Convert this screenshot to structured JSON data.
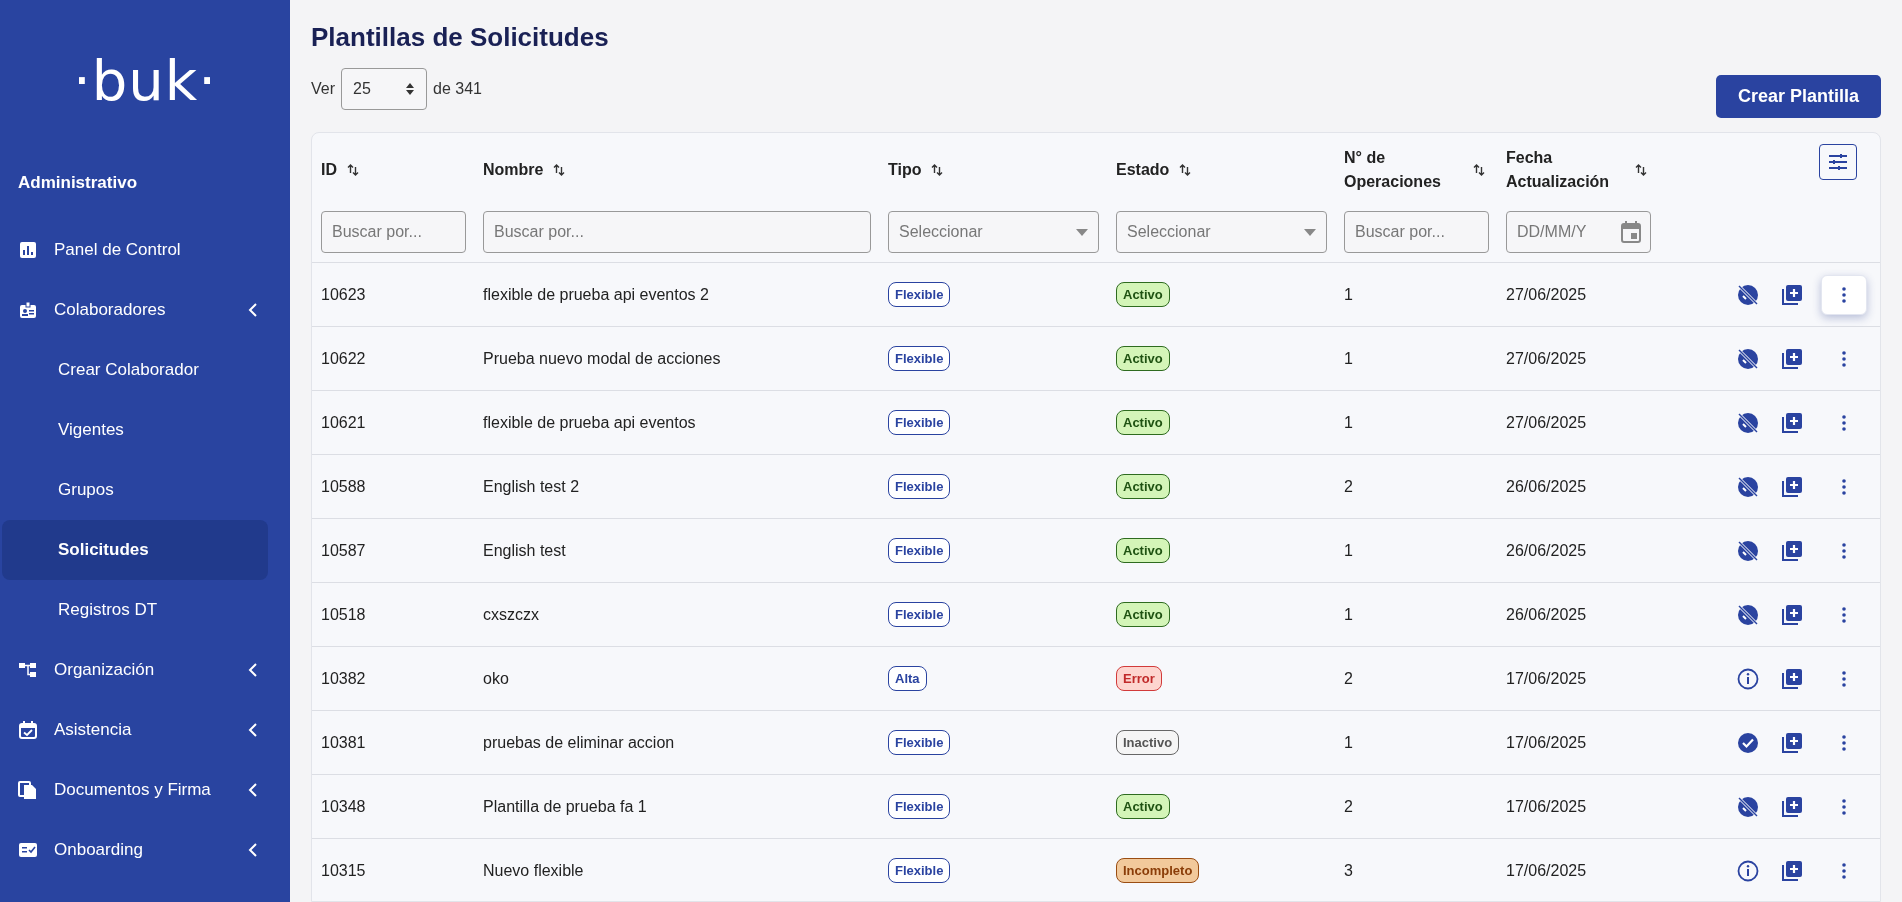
{
  "sidebar": {
    "logo": "·buk·",
    "section": "Administrativo",
    "items": [
      {
        "label": "Panel de Control",
        "selected": false
      },
      {
        "label": "Colaboradores",
        "selected": false,
        "children": [
          {
            "label": "Crear Colaborador",
            "selected": false
          },
          {
            "label": "Vigentes",
            "selected": false
          },
          {
            "label": "Grupos",
            "selected": false
          },
          {
            "label": "Solicitudes",
            "selected": true
          },
          {
            "label": "Registros DT",
            "selected": false
          }
        ]
      },
      {
        "label": "Organización",
        "selected": false
      },
      {
        "label": "Asistencia",
        "selected": false
      },
      {
        "label": "Documentos y Firma",
        "selected": false
      },
      {
        "label": "Onboarding",
        "selected": false
      }
    ]
  },
  "page": {
    "title": "Plantillas de Solicitudes",
    "show_label": "Ver",
    "page_size": "25",
    "total": "de 341",
    "create_button": "Crear Plantilla"
  },
  "table": {
    "columns": [
      {
        "label": "ID",
        "filter": {
          "kind": "text",
          "placeholder": "Buscar por..."
        }
      },
      {
        "label": "Nombre",
        "filter": {
          "kind": "text",
          "placeholder": "Buscar por..."
        }
      },
      {
        "label": "Tipo",
        "filter": {
          "kind": "select",
          "placeholder": "Seleccionar"
        }
      },
      {
        "label": "Estado",
        "filter": {
          "kind": "select",
          "placeholder": "Seleccionar"
        }
      },
      {
        "label": "N° de Operaciones",
        "filter": {
          "kind": "text",
          "placeholder": "Buscar por..."
        }
      },
      {
        "label": "Fecha Actualización",
        "filter": {
          "kind": "date",
          "placeholder": "DD/MM/Y"
        }
      }
    ],
    "rows": [
      {
        "id": "10623",
        "name": "flexible de prueba api eventos 2",
        "type": "Flexible",
        "status": {
          "label": "Activo",
          "kind": "active"
        },
        "operations": "1",
        "date": "27/06/2025",
        "action": {
          "kind": "hidden"
        },
        "menu_focused": true
      },
      {
        "id": "10622",
        "name": "Prueba nuevo modal de acciones",
        "type": "Flexible",
        "status": {
          "label": "Activo",
          "kind": "active"
        },
        "operations": "1",
        "date": "27/06/2025",
        "action": {
          "kind": "hidden"
        },
        "menu_focused": false
      },
      {
        "id": "10621",
        "name": "flexible de prueba api eventos",
        "type": "Flexible",
        "status": {
          "label": "Activo",
          "kind": "active"
        },
        "operations": "1",
        "date": "27/06/2025",
        "action": {
          "kind": "hidden"
        },
        "menu_focused": false
      },
      {
        "id": "10588",
        "name": "English test 2",
        "type": "Flexible",
        "status": {
          "label": "Activo",
          "kind": "active"
        },
        "operations": "2",
        "date": "26/06/2025",
        "action": {
          "kind": "hidden"
        },
        "menu_focused": false
      },
      {
        "id": "10587",
        "name": "English test",
        "type": "Flexible",
        "status": {
          "label": "Activo",
          "kind": "active"
        },
        "operations": "1",
        "date": "26/06/2025",
        "action": {
          "kind": "hidden"
        },
        "menu_focused": false
      },
      {
        "id": "10518",
        "name": "cxszczx",
        "type": "Flexible",
        "status": {
          "label": "Activo",
          "kind": "active"
        },
        "operations": "1",
        "date": "26/06/2025",
        "action": {
          "kind": "hidden"
        },
        "menu_focused": false
      },
      {
        "id": "10382",
        "name": "oko",
        "type": "Alta",
        "status": {
          "label": "Error",
          "kind": "error"
        },
        "operations": "2",
        "date": "17/06/2025",
        "action": {
          "kind": "info"
        },
        "menu_focused": false
      },
      {
        "id": "10381",
        "name": "pruebas de eliminar accion",
        "type": "Flexible",
        "status": {
          "label": "Inactivo",
          "kind": "inactive"
        },
        "operations": "1",
        "date": "17/06/2025",
        "action": {
          "kind": "check"
        },
        "menu_focused": false
      },
      {
        "id": "10348",
        "name": "Plantilla de prueba fa 1",
        "type": "Flexible",
        "status": {
          "label": "Activo",
          "kind": "active"
        },
        "operations": "2",
        "date": "17/06/2025",
        "action": {
          "kind": "hidden"
        },
        "menu_focused": false
      },
      {
        "id": "10315",
        "name": "Nuevo flexible",
        "type": "Flexible",
        "status": {
          "label": "Incompleto",
          "kind": "incomplete"
        },
        "operations": "3",
        "date": "17/06/2025",
        "action": {
          "kind": "info"
        },
        "menu_focused": false
      }
    ]
  }
}
